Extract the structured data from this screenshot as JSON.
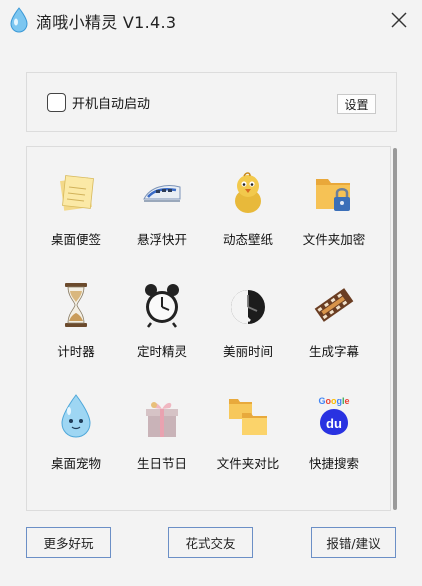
{
  "window": {
    "title": "滴哦小精灵 V1.4.3"
  },
  "options": {
    "autostart_label": "开机自动启动",
    "autostart_checked": false,
    "settings_label": "设置"
  },
  "tools": [
    {
      "label": "桌面便签",
      "icon": "sticky-note-icon"
    },
    {
      "label": "悬浮快开",
      "icon": "bullet-train-icon"
    },
    {
      "label": "动态壁纸",
      "icon": "chick-icon"
    },
    {
      "label": "文件夹加密",
      "icon": "folder-lock-icon"
    },
    {
      "label": "计时器",
      "icon": "hourglass-icon"
    },
    {
      "label": "定时精灵",
      "icon": "alarm-clock-icon"
    },
    {
      "label": "美丽时间",
      "icon": "clock-face-icon"
    },
    {
      "label": "生成字幕",
      "icon": "film-strip-icon"
    },
    {
      "label": "桌面宠物",
      "icon": "water-drop-pet-icon"
    },
    {
      "label": "生日节日",
      "icon": "gift-box-icon"
    },
    {
      "label": "文件夹对比",
      "icon": "folder-compare-icon"
    },
    {
      "label": "快捷搜索",
      "icon": "baidu-search-icon"
    }
  ],
  "footer": {
    "more_label": "更多好玩",
    "friends_label": "花式交友",
    "feedback_label": "报错/建议"
  }
}
